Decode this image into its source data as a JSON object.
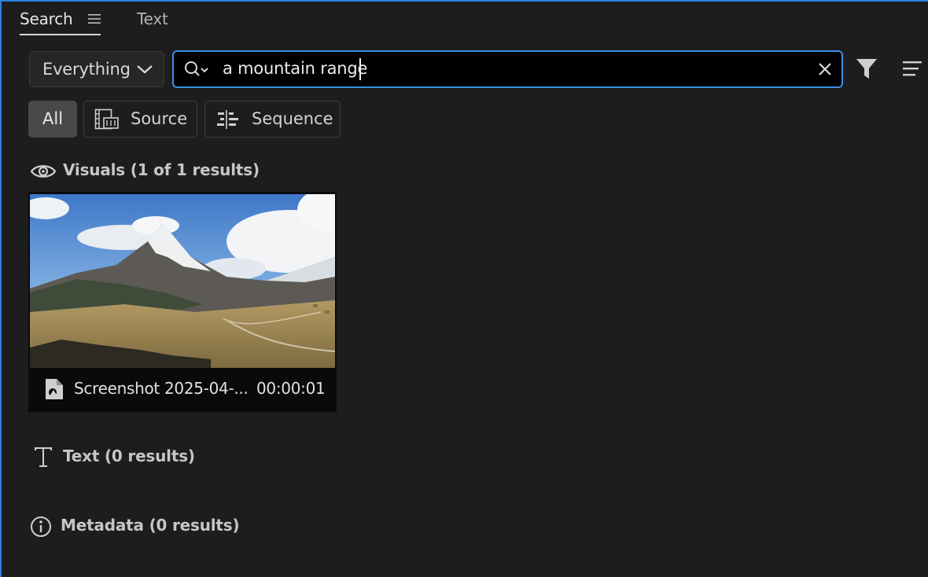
{
  "tabs": {
    "search_label": "Search",
    "text_label": "Text"
  },
  "search_bar": {
    "scope_value": "Everything",
    "query": "a mountain range"
  },
  "chips": {
    "all_label": "All",
    "source_label": "Source",
    "sequence_label": "Sequence"
  },
  "sections": {
    "visuals_label": "Visuals",
    "visuals_count": "(1 of 1 results)",
    "text_label": "Text",
    "text_count": "(0 results)",
    "metadata_label": "Metadata",
    "metadata_count": "(0 results)"
  },
  "results": [
    {
      "name": "Screenshot 2025-04-...",
      "duration": "00:00:01"
    }
  ],
  "icons": {
    "tab_menu": "hamburger-icon",
    "scope_chevron": "chevron-down-icon",
    "search": "search-options-icon",
    "clear": "close-icon",
    "filter": "filter-icon",
    "view_options": "list-options-icon",
    "source": "source-clip-icon",
    "sequence": "sequence-icon",
    "visuals": "eye-icon",
    "text": "text-type-icon",
    "metadata": "info-icon",
    "result_file": "image-file-icon"
  },
  "colors": {
    "background": "#1d1d1d",
    "accent": "#3d8ee6",
    "chip_active": "#494949",
    "input_bg": "#000000"
  }
}
